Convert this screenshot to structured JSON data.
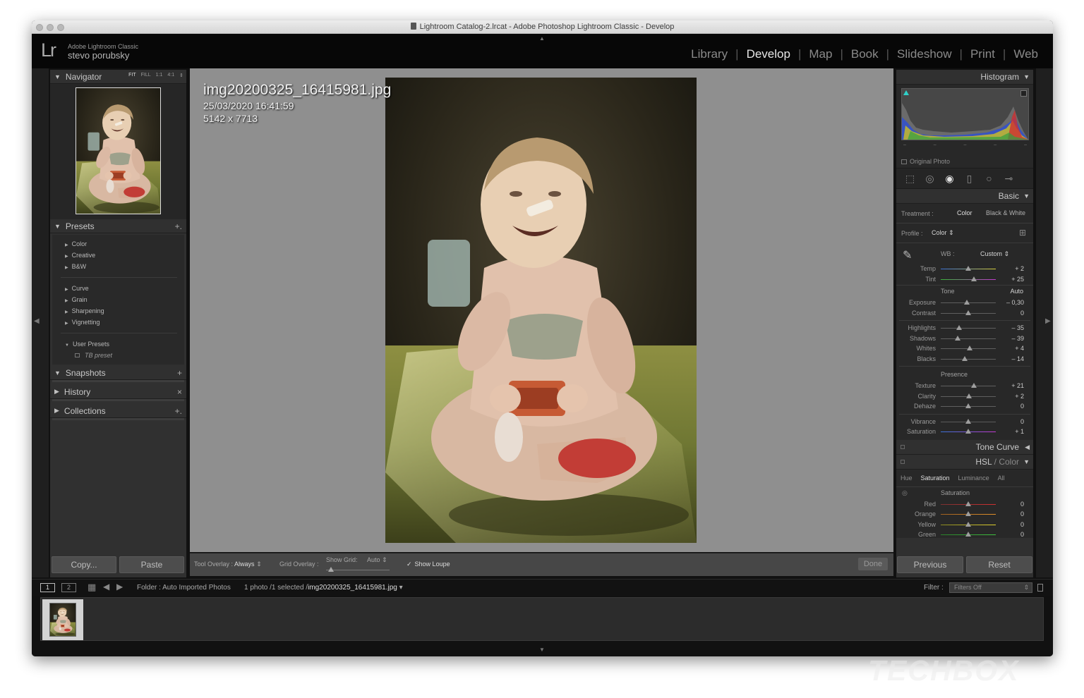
{
  "window": {
    "title": "Lightroom Catalog-2.lrcat - Adobe Photoshop Lightroom Classic - Develop"
  },
  "identity_plate": {
    "app_name": "Adobe Lightroom Classic",
    "user_name": "stevo porubsky",
    "logo_text": "Lr"
  },
  "modules": [
    {
      "label": "Library",
      "active": false
    },
    {
      "label": "Develop",
      "active": true
    },
    {
      "label": "Map",
      "active": false
    },
    {
      "label": "Book",
      "active": false
    },
    {
      "label": "Slideshow",
      "active": false
    },
    {
      "label": "Print",
      "active": false
    },
    {
      "label": "Web",
      "active": false
    }
  ],
  "left_panel": {
    "navigator": {
      "title": "Navigator",
      "options": [
        "FIT",
        "FILL",
        "1:1",
        "4:1"
      ]
    },
    "presets": {
      "title": "Presets",
      "groups": [
        [
          "Color",
          "Creative",
          "B&W"
        ],
        [
          "Curve",
          "Grain",
          "Sharpening",
          "Vignetting"
        ]
      ],
      "user_presets": {
        "title": "User Presets",
        "items": [
          "TB preset"
        ]
      }
    },
    "snapshots": {
      "title": "Snapshots"
    },
    "history": {
      "title": "History"
    },
    "collections": {
      "title": "Collections"
    },
    "copy_label": "Copy...",
    "paste_label": "Paste"
  },
  "photo_info": {
    "filename": "img20200325_16415981.jpg",
    "datetime": "25/03/2020 16:41:59",
    "dimensions": "5142 x 7713"
  },
  "toolbar": {
    "tool_overlay_label": "Tool Overlay :",
    "tool_overlay_value": "Always",
    "grid_overlay_label": "Grid Overlay :",
    "show_grid_label": "Show Grid:",
    "show_grid_value": "Auto",
    "show_loupe_label": "Show Loupe",
    "done_label": "Done"
  },
  "right_panel": {
    "histogram": {
      "title": "Histogram",
      "original_photo_label": "Original Photo"
    },
    "basic": {
      "title": "Basic",
      "treatment_label": "Treatment :",
      "treatment_color": "Color",
      "treatment_bw": "Black & White",
      "profile_label": "Profile :",
      "profile_value": "Color",
      "wb_label": "WB :",
      "wb_value": "Custom",
      "wb_sliders": [
        {
          "label": "Temp",
          "value": "+ 2",
          "pos": 0.5
        },
        {
          "label": "Tint",
          "value": "+ 25",
          "pos": 0.6
        }
      ],
      "tone_title": "Tone",
      "tone_auto": "Auto",
      "tone_sliders_a": [
        {
          "label": "Exposure",
          "value": "– 0,30",
          "pos": 0.47
        },
        {
          "label": "Contrast",
          "value": "0",
          "pos": 0.5
        }
      ],
      "tone_sliders_b": [
        {
          "label": "Highlights",
          "value": "– 35",
          "pos": 0.33
        },
        {
          "label": "Shadows",
          "value": "– 39",
          "pos": 0.31
        },
        {
          "label": "Whites",
          "value": "+ 4",
          "pos": 0.52
        },
        {
          "label": "Blacks",
          "value": "– 14",
          "pos": 0.43
        }
      ],
      "presence_title": "Presence",
      "presence_sliders_a": [
        {
          "label": "Texture",
          "value": "+ 21",
          "pos": 0.6
        },
        {
          "label": "Clarity",
          "value": "+ 2",
          "pos": 0.51
        },
        {
          "label": "Dehaze",
          "value": "0",
          "pos": 0.5
        }
      ],
      "presence_sliders_b": [
        {
          "label": "Vibrance",
          "value": "0",
          "pos": 0.5
        },
        {
          "label": "Saturation",
          "value": "+ 1",
          "pos": 0.5
        }
      ]
    },
    "tone_curve": {
      "title": "Tone Curve"
    },
    "hsl": {
      "title_hsl": "HSL",
      "title_sep": " / ",
      "title_color": "Color",
      "tabs": [
        "Hue",
        "Saturation",
        "Luminance",
        "All"
      ],
      "active_tab": "Saturation",
      "sub_title": "Saturation",
      "sliders": [
        {
          "label": "Red",
          "value": "0",
          "pos": 0.5
        },
        {
          "label": "Orange",
          "value": "0",
          "pos": 0.5
        },
        {
          "label": "Yellow",
          "value": "0",
          "pos": 0.5
        },
        {
          "label": "Green",
          "value": "0",
          "pos": 0.5
        }
      ]
    },
    "previous_label": "Previous",
    "reset_label": "Reset"
  },
  "filmbar": {
    "screen1": "1",
    "screen2": "2",
    "folder_text": "Folder : Auto Imported Photos",
    "selection_text": "1 photo /1 selected /",
    "selected_file": "img20200325_16415981.jpg",
    "filter_label": "Filter :",
    "filter_value": "Filters Off"
  },
  "watermark": "TECHBOX"
}
